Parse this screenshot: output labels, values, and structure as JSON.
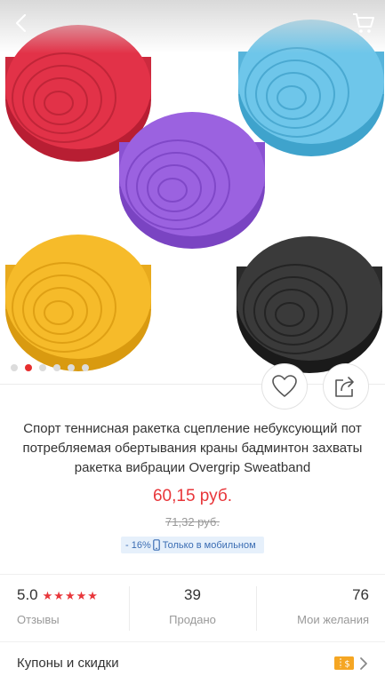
{
  "hero": {
    "image_alt": "Overgrip rolls in red, blue, purple, yellow and black",
    "rolls": [
      {
        "name": "red",
        "color": "#e23248",
        "dark": "#b81e33"
      },
      {
        "name": "blue",
        "color": "#6ec6ea",
        "dark": "#3fa3cc"
      },
      {
        "name": "purple",
        "color": "#9b62e0",
        "dark": "#7a44c2"
      },
      {
        "name": "yellow",
        "color": "#f6bb2a",
        "dark": "#d99a10"
      },
      {
        "name": "black",
        "color": "#3a3a3a",
        "dark": "#1a1a1a"
      }
    ],
    "active_slide": 2,
    "slide_count": 6
  },
  "nav": {
    "back_icon": "chevron-left-icon",
    "cart_icon": "cart-icon"
  },
  "product": {
    "title": "Спорт теннисная ракетка сцепление небуксующий пот потребляемая обертывания краны бадминтон захваты ракетка вибрации Overgrip Sweatband",
    "price": "60,15 руб.",
    "old_price": "71,32 руб.",
    "discount_badge": "- 16%",
    "mobile_only": "Только в мобильном"
  },
  "stats": {
    "rating": "5.0",
    "rating_label": "Отзывы",
    "stars": 5,
    "sold": "39",
    "sold_label": "Продано",
    "wishes": "76",
    "wishes_label": "Мои желания"
  },
  "coupons": {
    "label": "Купоны и скидки",
    "coupon_icon_text": "$"
  },
  "colors": {
    "accent": "#e8363a",
    "badge_bg": "#e6f0fb",
    "badge_text": "#3b6db3"
  }
}
